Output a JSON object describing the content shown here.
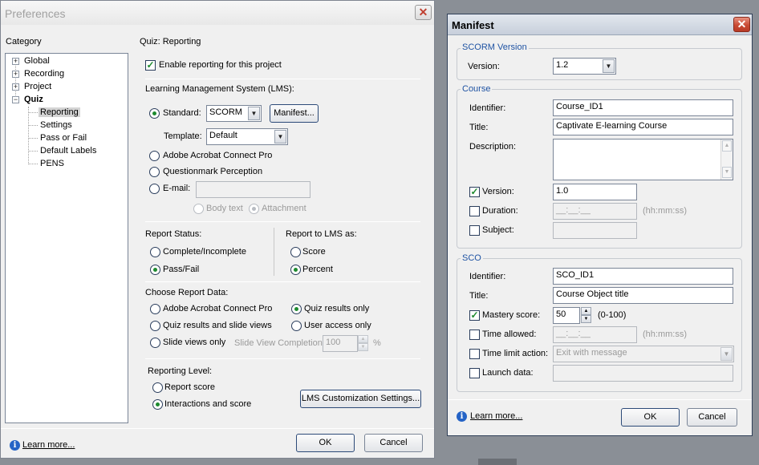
{
  "preferences": {
    "title": "Preferences",
    "category_label": "Category",
    "tree": [
      {
        "label": "Global"
      },
      {
        "label": "Recording"
      },
      {
        "label": "Project"
      },
      {
        "label": "Quiz"
      },
      {
        "label": "Reporting"
      },
      {
        "label": "Settings"
      },
      {
        "label": "Pass or Fail"
      },
      {
        "label": "Default Labels"
      },
      {
        "label": "PENS"
      }
    ],
    "section_title": "Quiz: Reporting",
    "enable_reporting": "Enable reporting for this project",
    "lms_label": "Learning Management System (LMS):",
    "standard_label": "Standard:",
    "standard_value": "SCORM",
    "manifest_button": "Manifest...",
    "template_label": "Template:",
    "template_value": "Default",
    "acrobat_connect": "Adobe Acrobat Connect Pro",
    "questionmark": "Questionmark Perception",
    "email_label": "E-mail:",
    "body_text": "Body text",
    "attachment": "Attachment",
    "report_status_label": "Report Status:",
    "complete_incomplete": "Complete/Incomplete",
    "pass_fail": "Pass/Fail",
    "report_to_lms_label": "Report to LMS as:",
    "score": "Score",
    "percent": "Percent",
    "choose_report_label": "Choose Report Data:",
    "crd_acrobat": "Adobe Acrobat Connect Pro",
    "quiz_results_only": "Quiz results only",
    "quiz_results_slide_views": "Quiz results and slide views",
    "user_access_only": "User access only",
    "slide_views_only": "Slide views only",
    "slide_view_completion_label": "Slide View Completion:",
    "slide_view_completion_value": "100",
    "percent_sign": "%",
    "reporting_level_label": "Reporting Level:",
    "report_score": "Report score",
    "interactions_score": "Interactions and score",
    "lms_customization_button": "LMS Customization Settings...",
    "learn_more": "Learn more...",
    "ok": "OK",
    "cancel": "Cancel"
  },
  "manifest": {
    "title": "Manifest",
    "scorm_version_group": "SCORM Version",
    "version_label": "Version:",
    "version_value": "1.2",
    "course_group": "Course",
    "identifier_label": "Identifier:",
    "identifier_value": "Course_ID1",
    "title_label": "Title:",
    "title_value": "Captivate E-learning Course",
    "description_label": "Description:",
    "course_version_label": "Version:",
    "course_version_value": "1.0",
    "duration_label": "Duration:",
    "duration_value": "__:__:__",
    "duration_hint": "(hh:mm:ss)",
    "subject_label": "Subject:",
    "sco_group": "SCO",
    "sco_identifier_label": "Identifier:",
    "sco_identifier_value": "SCO_ID1",
    "sco_title_label": "Title:",
    "sco_title_value": "Course Object title",
    "mastery_label": "Mastery score:",
    "mastery_value": "50",
    "mastery_range": "(0-100)",
    "time_allowed_label": "Time allowed:",
    "time_allowed_value": "__:__:__",
    "time_allowed_hint": "(hh:mm:ss)",
    "time_limit_label": "Time limit action:",
    "time_limit_value": "Exit with message",
    "launch_data_label": "Launch data:",
    "learn_more": "Learn more...",
    "ok": "OK",
    "cancel": "Cancel"
  },
  "colors": {
    "group_title": "#1f53a3",
    "check_green": "#1d8a2e",
    "close_red": "#c94a34"
  }
}
